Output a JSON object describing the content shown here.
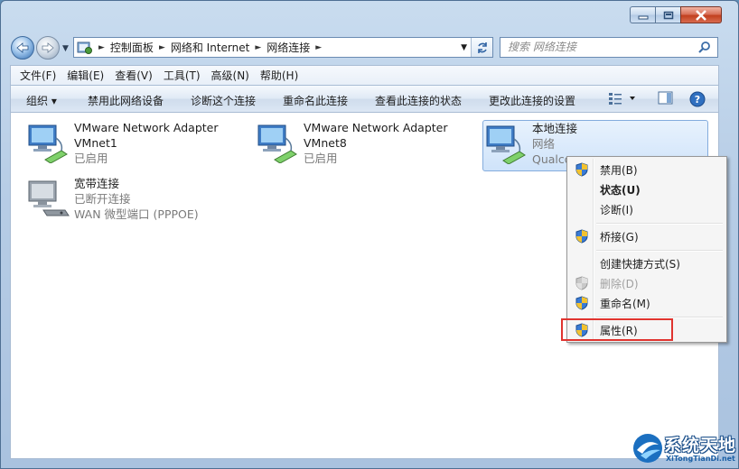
{
  "window": {
    "caption_min": "–",
    "caption_max": "□",
    "caption_close": "✕"
  },
  "address": {
    "crumbs": [
      "控制面板",
      "网络和 Internet",
      "网络连接"
    ],
    "separator": "►"
  },
  "search": {
    "placeholder": "搜索 网络连接"
  },
  "menubar": {
    "items": [
      "文件(F)",
      "编辑(E)",
      "查看(V)",
      "工具(T)",
      "高级(N)",
      "帮助(H)"
    ]
  },
  "cmdbar": {
    "organize": "组织 ▾",
    "disable": "禁用此网络设备",
    "diagnose": "诊断这个连接",
    "rename": "重命名此连接",
    "status": "查看此连接的状态",
    "change_settings": "更改此连接的设置"
  },
  "adapters": [
    {
      "name": "VMware Network Adapter",
      "line2": "VMnet1",
      "status": "已启用"
    },
    {
      "name": "VMware Network Adapter",
      "line2": "VMnet8",
      "status": "已启用"
    },
    {
      "name": "本地连接",
      "line2": "网络",
      "status": "Qualco"
    },
    {
      "name": "宽带连接",
      "line2": "已断开连接",
      "status": "WAN 微型端口 (PPPOE)"
    }
  ],
  "context_menu": {
    "items": [
      "禁用(B)",
      "状态(U)",
      "诊断(I)",
      "桥接(G)",
      "创建快捷方式(S)",
      "删除(D)",
      "重命名(M)",
      "属性(R)"
    ]
  },
  "watermark": {
    "title": "系统天地",
    "url": "XiTongTianDi.net"
  },
  "colors": {
    "highlight_border": "#e0342f",
    "selection_border": "#84acdd"
  }
}
